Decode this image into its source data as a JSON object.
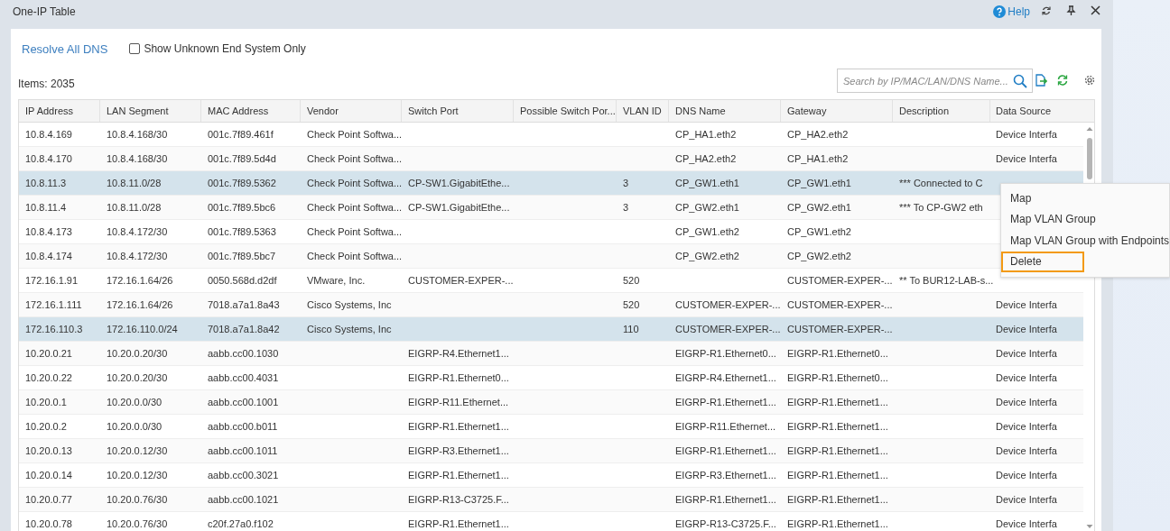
{
  "window": {
    "title": "One-IP Table",
    "help": "Help"
  },
  "toolbar": {
    "link": "Resolve All DNS",
    "checkbox": {
      "label": "Show Unknown End System Only",
      "checked": false
    }
  },
  "items_count": "Items: 2035",
  "search": {
    "placeholder": "Search by IP/MAC/LAN/DNS Name..."
  },
  "table": {
    "columns": [
      "IP Address",
      "LAN Segment",
      "MAC Address",
      "Vendor",
      "Switch Port",
      "Possible Switch Por...",
      "VLAN ID",
      "DNS Name",
      "Gateway",
      "Description",
      "Data Source"
    ],
    "rows": [
      {
        "selected": false,
        "cells": [
          "10.8.4.169",
          "10.8.4.168/30",
          "001c.7f89.461f",
          "Check Point Softwa...",
          null,
          null,
          null,
          "CP_HA1.eth2",
          "CP_HA2.eth2",
          null,
          "Device Interfa"
        ]
      },
      {
        "selected": false,
        "cells": [
          "10.8.4.170",
          "10.8.4.168/30",
          "001c.7f89.5d4d",
          "Check Point Softwa...",
          null,
          null,
          null,
          "CP_HA2.eth2",
          "CP_HA1.eth2",
          null,
          "Device Interfa"
        ]
      },
      {
        "selected": true,
        "cells": [
          "10.8.11.3",
          "10.8.11.0/28",
          "001c.7f89.5362",
          "Check Point Softwa...",
          "CP-SW1.GigabitEthe...",
          null,
          "3",
          "CP_GW1.eth1",
          "CP_GW1.eth1",
          "*** Connected to C",
          null
        ]
      },
      {
        "selected": false,
        "cells": [
          "10.8.11.4",
          "10.8.11.0/28",
          "001c.7f89.5bc6",
          "Check Point Softwa...",
          "CP-SW1.GigabitEthe...",
          null,
          "3",
          "CP_GW2.eth1",
          "CP_GW2.eth1",
          "*** To CP-GW2 eth",
          null
        ]
      },
      {
        "selected": false,
        "cells": [
          "10.8.4.173",
          "10.8.4.172/30",
          "001c.7f89.5363",
          "Check Point Softwa...",
          null,
          null,
          null,
          "CP_GW1.eth2",
          "CP_GW1.eth2",
          null,
          null
        ]
      },
      {
        "selected": false,
        "cells": [
          "10.8.4.174",
          "10.8.4.172/30",
          "001c.7f89.5bc7",
          "Check Point Softwa...",
          null,
          null,
          null,
          "CP_GW2.eth2",
          "CP_GW2.eth2",
          null,
          null
        ]
      },
      {
        "selected": false,
        "cells": [
          "172.16.1.91",
          "172.16.1.64/26",
          "0050.568d.d2df",
          "VMware, Inc.",
          "CUSTOMER-EXPER-...",
          null,
          "520",
          null,
          "CUSTOMER-EXPER-...",
          "** To BUR12-LAB-s...",
          null
        ]
      },
      {
        "selected": false,
        "cells": [
          "172.16.1.111",
          "172.16.1.64/26",
          "7018.a7a1.8a43",
          "Cisco Systems, Inc",
          null,
          null,
          "520",
          "CUSTOMER-EXPER-...",
          "CUSTOMER-EXPER-...",
          null,
          "Device Interfa"
        ]
      },
      {
        "selected": true,
        "cells": [
          "172.16.110.3",
          "172.16.110.0/24",
          "7018.a7a1.8a42",
          "Cisco Systems, Inc",
          null,
          null,
          "110",
          "CUSTOMER-EXPER-...",
          "CUSTOMER-EXPER-...",
          null,
          "Device Interfa"
        ]
      },
      {
        "selected": false,
        "cells": [
          "10.20.0.21",
          "10.20.0.20/30",
          "aabb.cc00.1030",
          null,
          "EIGRP-R4.Ethernet1...",
          null,
          null,
          "EIGRP-R1.Ethernet0...",
          "EIGRP-R1.Ethernet0...",
          null,
          "Device Interfa"
        ]
      },
      {
        "selected": false,
        "cells": [
          "10.20.0.22",
          "10.20.0.20/30",
          "aabb.cc00.4031",
          null,
          "EIGRP-R1.Ethernet0...",
          null,
          null,
          "EIGRP-R4.Ethernet1...",
          "EIGRP-R1.Ethernet0...",
          null,
          "Device Interfa"
        ]
      },
      {
        "selected": false,
        "cells": [
          "10.20.0.1",
          "10.20.0.0/30",
          "aabb.cc00.1001",
          null,
          "EIGRP-R11.Ethernet...",
          null,
          null,
          "EIGRP-R1.Ethernet1...",
          "EIGRP-R1.Ethernet1...",
          null,
          "Device Interfa"
        ]
      },
      {
        "selected": false,
        "cells": [
          "10.20.0.2",
          "10.20.0.0/30",
          "aabb.cc00.b011",
          null,
          "EIGRP-R1.Ethernet1...",
          null,
          null,
          "EIGRP-R11.Ethernet...",
          "EIGRP-R1.Ethernet1...",
          null,
          "Device Interfa"
        ]
      },
      {
        "selected": false,
        "cells": [
          "10.20.0.13",
          "10.20.0.12/30",
          "aabb.cc00.1011",
          null,
          "EIGRP-R3.Ethernet1...",
          null,
          null,
          "EIGRP-R1.Ethernet1...",
          "EIGRP-R1.Ethernet1...",
          null,
          "Device Interfa"
        ]
      },
      {
        "selected": false,
        "cells": [
          "10.20.0.14",
          "10.20.0.12/30",
          "aabb.cc00.3021",
          null,
          "EIGRP-R1.Ethernet1...",
          null,
          null,
          "EIGRP-R3.Ethernet1...",
          "EIGRP-R1.Ethernet1...",
          null,
          "Device Interfa"
        ]
      },
      {
        "selected": false,
        "cells": [
          "10.20.0.77",
          "10.20.0.76/30",
          "aabb.cc00.1021",
          null,
          "EIGRP-R13-C3725.F...",
          null,
          null,
          "EIGRP-R1.Ethernet1...",
          "EIGRP-R1.Ethernet1...",
          null,
          "Device Interfa"
        ]
      },
      {
        "selected": false,
        "cells": [
          "10.20.0.78",
          "10.20.0.76/30",
          "c20f.27a0.f102",
          null,
          "EIGRP-R1.Ethernet1...",
          null,
          null,
          "EIGRP-R13-C3725.F...",
          "EIGRP-R1.Ethernet1...",
          null,
          "Device Interfa"
        ]
      }
    ]
  },
  "context_menu": [
    {
      "label": "Map",
      "highlighted": false
    },
    {
      "label": "Map VLAN Group",
      "highlighted": false
    },
    {
      "label": "Map VLAN Group with Endpoints",
      "highlighted": false
    },
    {
      "label": "Delete",
      "highlighted": true
    }
  ]
}
